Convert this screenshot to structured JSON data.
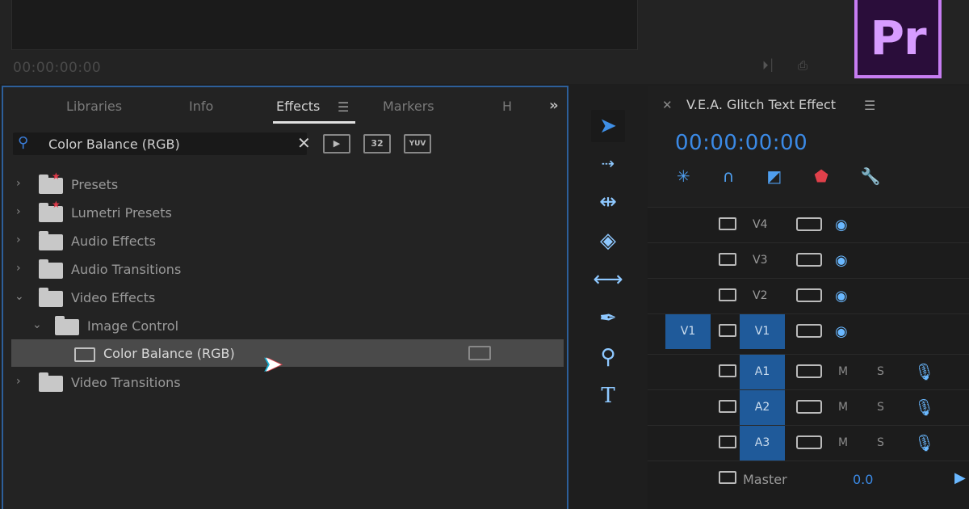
{
  "monitor": {
    "timecode": "00:00:00:00"
  },
  "logo": {
    "text": "Pr",
    "color": "#c77df2"
  },
  "effects_panel": {
    "tabs": [
      "Libraries",
      "Info",
      "Effects",
      "Markers",
      "H"
    ],
    "active_tab": "Effects",
    "overflow": "»",
    "search": {
      "value": "Color Balance (RGB)",
      "placeholder": ""
    },
    "filter_buttons": [
      "▶",
      "32",
      "YUV"
    ],
    "tree": [
      {
        "label": "Presets"
      },
      {
        "label": "Lumetri Presets"
      },
      {
        "label": "Audio Effects"
      },
      {
        "label": "Audio Transitions"
      },
      {
        "label": "Video Effects"
      },
      {
        "label": "Image Control"
      },
      {
        "label": "Color Balance (RGB)",
        "selected": true
      },
      {
        "label": "Video Transitions"
      }
    ]
  },
  "tools": [
    "selection-tool",
    "track-select-tool",
    "ripple-edit-tool",
    "razor-tool",
    "slip-tool",
    "pen-tool",
    "zoom-tool",
    "type-tool"
  ],
  "timeline": {
    "title": "V.E.A. Glitch Text Effect",
    "timecode": "00:00:00:00",
    "video_tracks": [
      {
        "name": "V4"
      },
      {
        "name": "V3"
      },
      {
        "name": "V2"
      },
      {
        "name": "V1",
        "source": "V1"
      }
    ],
    "audio_tracks": [
      {
        "name": "A1",
        "mute": "M",
        "solo": "S"
      },
      {
        "name": "A2",
        "mute": "M",
        "solo": "S"
      },
      {
        "name": "A3",
        "mute": "M",
        "solo": "S"
      }
    ],
    "master": {
      "label": "Master",
      "value": "0.0"
    }
  },
  "colors": {
    "accent_blue": "#3b8ae6",
    "panel_border": "#2d5f9a",
    "glitch_red": "#e0404a"
  }
}
